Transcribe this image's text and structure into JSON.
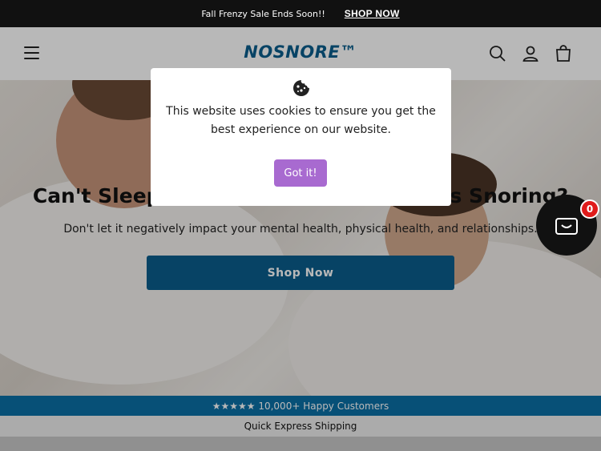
{
  "announcement": {
    "message": "Fall Frenzy Sale Ends Soon!!",
    "link_label": "SHOP NOW"
  },
  "header": {
    "logo": "NOSNORE™",
    "icons": [
      "menu-icon",
      "search-icon",
      "account-icon",
      "cart-icon"
    ]
  },
  "hero": {
    "title": "Can't Sleep Because Of Your Partner's Snoring?",
    "subtitle": "Don't let it negatively impact your mental health, physical health, and relationships.",
    "cta_label": "Shop Now"
  },
  "cookie_banner": {
    "icon": "cookie-icon",
    "text": "This website uses cookies to ensure you get the best experience on our website.",
    "button_label": "Got it!"
  },
  "floating_cart": {
    "icon": "basket-icon",
    "count": "0"
  },
  "trust_bar": {
    "reviews": "★★★★★ 10,000+ Happy Customers",
    "shipping": "Quick Express Shipping"
  },
  "colors": {
    "brand": "#0a5e8c",
    "trust_bar": "#0a6fa6",
    "cookie_button": "#a86ad0",
    "badge": "#e01b1b"
  }
}
